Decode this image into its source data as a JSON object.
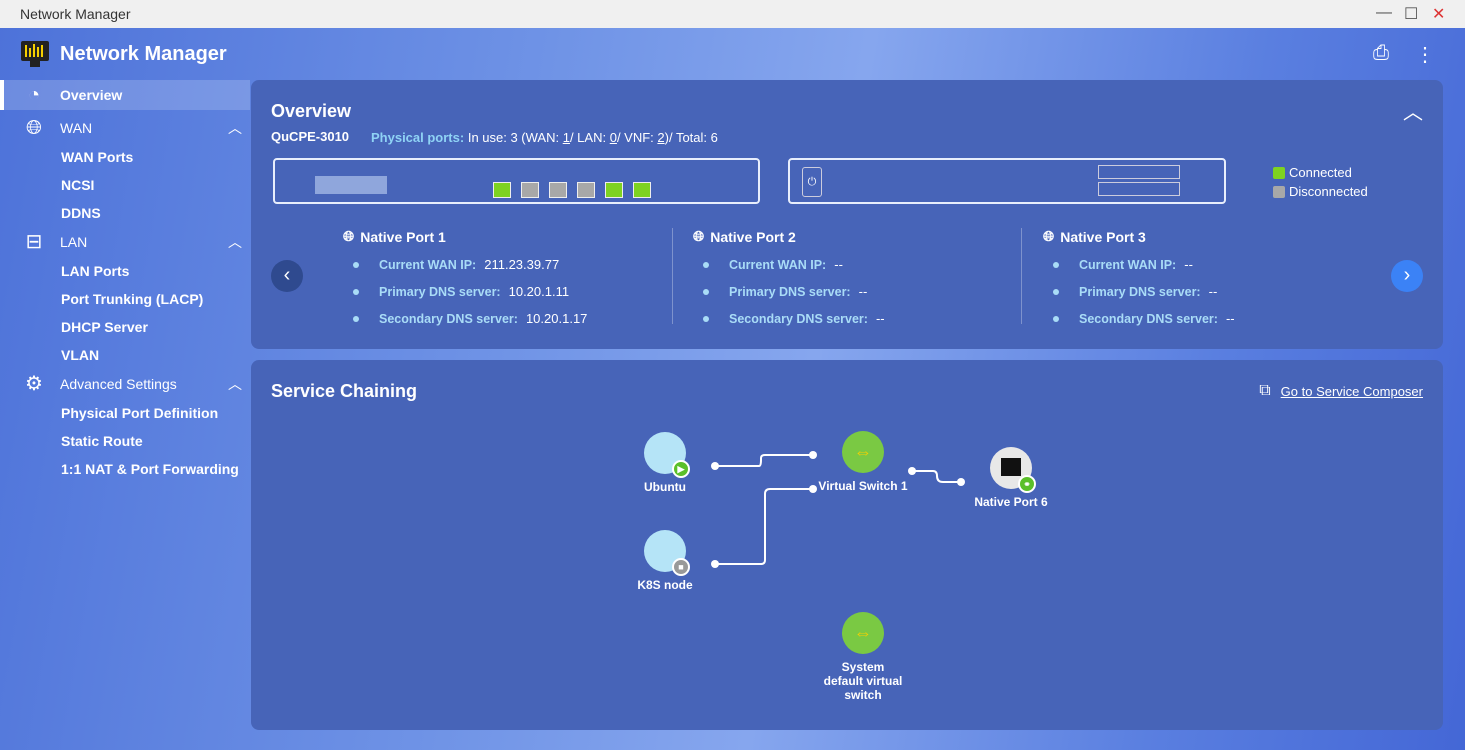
{
  "window": {
    "title": "Network Manager",
    "controls": [
      "minimize",
      "maximize",
      "close"
    ]
  },
  "app": {
    "title": "Network Manager",
    "print_icon": "printer-icon",
    "more_icon": "more-vertical-icon"
  },
  "sidebar": {
    "items": [
      {
        "label": "Overview",
        "icon": "gauge-icon",
        "active": true
      },
      {
        "label": "WAN",
        "icon": "globe-icon",
        "expanded": true,
        "children": [
          "WAN Ports",
          "NCSI",
          "DDNS"
        ]
      },
      {
        "label": "LAN",
        "icon": "ethernet-icon",
        "expanded": true,
        "children": [
          "LAN Ports",
          "Port Trunking (LACP)",
          "DHCP Server",
          "VLAN"
        ]
      },
      {
        "label": "Advanced Settings",
        "icon": "gear-icon",
        "expanded": true,
        "children": [
          "Physical Port Definition",
          "Static Route",
          "1:1 NAT & Port Forwarding"
        ]
      }
    ]
  },
  "overview": {
    "title": "Overview",
    "model": "QuCPE-3010",
    "ports_label": "Physical ports:",
    "ports_prefix": "In use: 3 (WAN: ",
    "wan": "1",
    "lan_prefix": "/ LAN: ",
    "lan": "0",
    "vnf_prefix": "/ VNF: ",
    "vnf": "2",
    "total_suffix": ")/ Total: 6",
    "port_states": [
      "connected",
      "disconnected",
      "disconnected",
      "disconnected",
      "connected",
      "connected"
    ],
    "legend": {
      "connected": "Connected",
      "disconnected": "Disconnected",
      "connected_color": "#7ed321",
      "disconnected_color": "#a8a8a8"
    },
    "native_ports": [
      {
        "name": "Native Port 1",
        "wan_ip_label": "Current WAN IP:",
        "wan_ip": "211.23.39.77",
        "dns1_label": "Primary DNS server:",
        "dns1": "10.20.1.11",
        "dns2_label": "Secondary DNS server:",
        "dns2": "10.20.1.17"
      },
      {
        "name": "Native Port 2",
        "wan_ip_label": "Current WAN IP:",
        "wan_ip": "--",
        "dns1_label": "Primary DNS server:",
        "dns1": "--",
        "dns2_label": "Secondary DNS server:",
        "dns2": "--"
      },
      {
        "name": "Native Port 3",
        "wan_ip_label": "Current WAN IP:",
        "wan_ip": "--",
        "dns1_label": "Primary DNS server:",
        "dns1": "--",
        "dns2_label": "Secondary DNS server:",
        "dns2": "--"
      }
    ]
  },
  "service_chaining": {
    "title": "Service Chaining",
    "link": "Go to Service Composer",
    "nodes": {
      "ubuntu": "Ubuntu",
      "k8s": "K8S node",
      "vswitch": "Virtual Switch 1",
      "native": "Native Port 6",
      "default_switch": "System default virtual switch"
    }
  }
}
